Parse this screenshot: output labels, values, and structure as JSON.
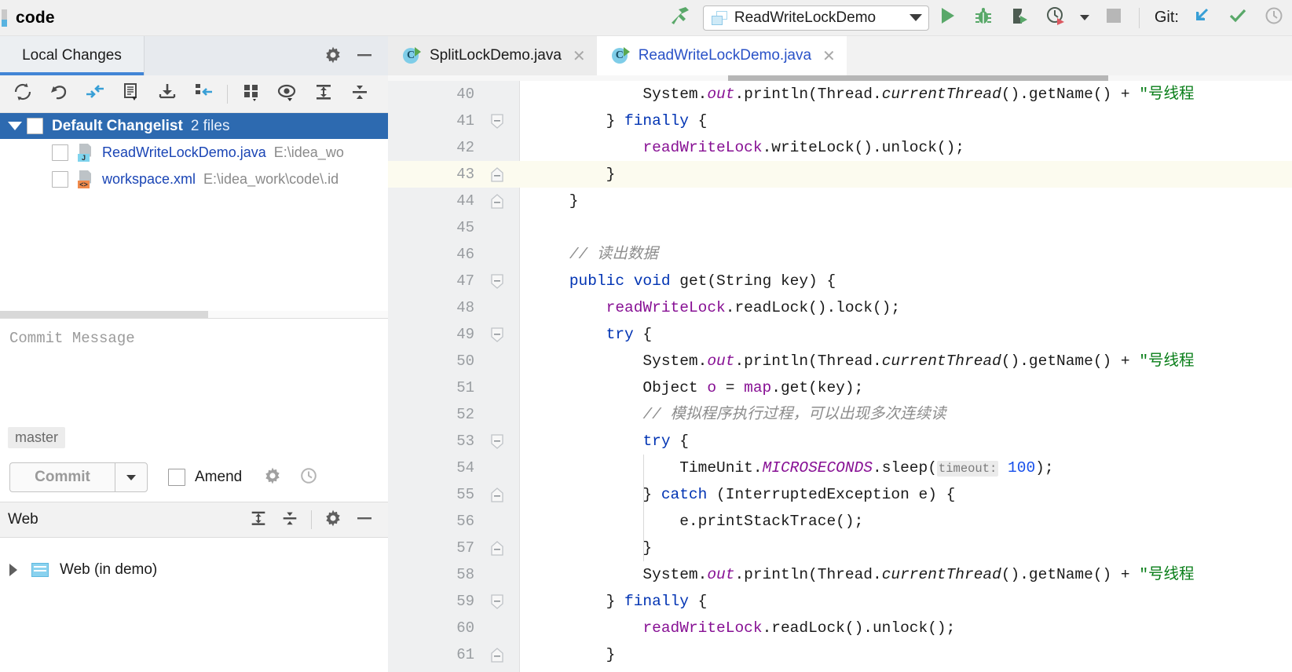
{
  "toolbar": {
    "project_name": "code",
    "build_icon": "hammer-icon",
    "run_config": {
      "label": "ReadWriteLockDemo",
      "icon": "application-config-icon"
    },
    "actions": [
      {
        "name": "run-button",
        "icon": "run-triangle-icon"
      },
      {
        "name": "debug-button",
        "icon": "bug-icon"
      },
      {
        "name": "run-with-coverage-button",
        "icon": "coverage-shield-icon"
      },
      {
        "name": "profiler-button",
        "icon": "clock-profiler-icon"
      },
      {
        "name": "stop-button",
        "icon": "stop-square-icon"
      }
    ],
    "git": {
      "label": "Git:",
      "update_icon": "update-arrow-icon",
      "commit_icon": "checkmark-icon",
      "history_icon": "clock-history-icon"
    }
  },
  "local_changes": {
    "tab_label": "Local Changes",
    "header_tools": [
      {
        "name": "settings-button",
        "icon": "gear-icon"
      },
      {
        "name": "hide-button",
        "icon": "minimize-icon"
      }
    ],
    "toolbar": [
      {
        "name": "refresh-button",
        "icon": "refresh-icon"
      },
      {
        "name": "rollback-button",
        "icon": "rollback-arrow-icon"
      },
      {
        "name": "show-diff-button",
        "icon": "diff-arrows-icon"
      },
      {
        "name": "edit-source-button",
        "icon": "document-icon"
      },
      {
        "name": "get-from-vcs-button",
        "icon": "download-icon"
      },
      {
        "name": "move-to-changelist-button",
        "icon": "move-changelist-icon"
      },
      {
        "name": "group-by-button",
        "icon": "group-by-icon"
      },
      {
        "name": "preview-diff-button",
        "icon": "eye-icon"
      },
      {
        "name": "expand-all-button",
        "icon": "expand-all-icon"
      },
      {
        "name": "collapse-all-button",
        "icon": "collapse-all-icon"
      }
    ],
    "changelist": {
      "name": "Default Changelist",
      "count_label": "2 files",
      "expanded": true
    },
    "files": [
      {
        "name": "ReadWriteLockDemo.java",
        "path": "E:\\idea_wo",
        "badge": "J",
        "badge_type": "java"
      },
      {
        "name": "workspace.xml",
        "path": "E:\\idea_work\\code\\.id",
        "badge": "<>",
        "badge_type": "xml"
      }
    ],
    "commit_message_placeholder": "Commit Message",
    "branch": "master",
    "commit_button": "Commit",
    "amend_label": "Amend",
    "commit_tools": [
      {
        "name": "commit-settings-button",
        "icon": "gear-icon"
      },
      {
        "name": "commit-history-button",
        "icon": "clock-history-icon"
      }
    ]
  },
  "web_panel": {
    "title": "Web",
    "tools": [
      {
        "name": "expand-all-button",
        "icon": "expand-all-icon"
      },
      {
        "name": "collapse-all-button",
        "icon": "collapse-all-icon"
      },
      {
        "name": "settings-button",
        "icon": "gear-icon"
      },
      {
        "name": "hide-button",
        "icon": "minimize-icon"
      }
    ],
    "node_label": "Web (in demo)",
    "node_expanded": false
  },
  "editor": {
    "tabs": [
      {
        "label": "SplitLockDemo.java",
        "active": false,
        "closable": true
      },
      {
        "label": "ReadWriteLockDemo.java",
        "active": true,
        "closable": true
      }
    ],
    "current_line": 43,
    "first_visible_line": 40,
    "lines": [
      {
        "n": 40,
        "fold": "",
        "indent": 0,
        "html": "            System.<span class=\"sfld\">out</span>.println(Thread.<span class=\"mth-i\">currentThread</span>().getName() + <span class=\"str\">\"号线程</span>"
      },
      {
        "n": 41,
        "fold": "start",
        "indent": 0,
        "html": "        } <span class=\"kw\">finally</span> {"
      },
      {
        "n": 42,
        "fold": "",
        "indent": 0,
        "html": "            <span class=\"fld\">readWriteLock</span>.writeLock().unlock();"
      },
      {
        "n": 43,
        "fold": "end",
        "indent": 0,
        "html": "        }"
      },
      {
        "n": 44,
        "fold": "end",
        "indent": 0,
        "html": "    }"
      },
      {
        "n": 45,
        "fold": "",
        "indent": 0,
        "html": ""
      },
      {
        "n": 46,
        "fold": "",
        "indent": 0,
        "html": "    <span class=\"cmt\">// 读出数据</span>"
      },
      {
        "n": 47,
        "fold": "start",
        "indent": 0,
        "html": "    <span class=\"kw\">public</span> <span class=\"kw\">void</span> get(String key) {"
      },
      {
        "n": 48,
        "fold": "",
        "indent": 0,
        "html": "        <span class=\"fld\">readWriteLock</span>.readLock().lock();"
      },
      {
        "n": 49,
        "fold": "start",
        "indent": 0,
        "html": "        <span class=\"kw\">try</span> {"
      },
      {
        "n": 50,
        "fold": "",
        "indent": 0,
        "html": "            System.<span class=\"sfld\">out</span>.println(Thread.<span class=\"mth-i\">currentThread</span>().getName() + <span class=\"str\">\"号线程</span>"
      },
      {
        "n": 51,
        "fold": "",
        "indent": 0,
        "html": "            Object <span class=\"fld\">o</span> = <span class=\"fld\">map</span>.get(key);"
      },
      {
        "n": 52,
        "fold": "",
        "indent": 0,
        "html": "            <span class=\"cmt\">// 模拟程序执行过程，可以出现多次连续读</span>"
      },
      {
        "n": 53,
        "fold": "start",
        "indent": 0,
        "html": "            <span class=\"kw\">try</span> {"
      },
      {
        "n": 54,
        "fold": "",
        "indent": 1,
        "html": "                TimeUnit.<span class=\"sfld\">MICROSECONDS</span>.sleep(<span class=\"param-hint\">timeout:</span> <span class=\"num\">100</span>);"
      },
      {
        "n": 55,
        "fold": "end",
        "indent": 1,
        "html": "            } <span class=\"kw\">catch</span> (InterruptedException e) {"
      },
      {
        "n": 56,
        "fold": "",
        "indent": 1,
        "html": "                e.printStackTrace();"
      },
      {
        "n": 57,
        "fold": "end",
        "indent": 1,
        "html": "            }"
      },
      {
        "n": 58,
        "fold": "",
        "indent": 0,
        "html": "            System.<span class=\"sfld\">out</span>.println(Thread.<span class=\"mth-i\">currentThread</span>().getName() + <span class=\"str\">\"号线程</span>"
      },
      {
        "n": 59,
        "fold": "start",
        "indent": 0,
        "html": "        } <span class=\"kw\">finally</span> {"
      },
      {
        "n": 60,
        "fold": "",
        "indent": 0,
        "html": "            <span class=\"fld\">readWriteLock</span>.readLock().unlock();"
      },
      {
        "n": 61,
        "fold": "end",
        "indent": 0,
        "html": "        }"
      }
    ]
  },
  "colors": {
    "selection_blue": "#2d6ab0",
    "accent_blue": "#4285d6",
    "link_blue": "#1a45b5",
    "keyword": "#0033b3",
    "string_green": "#077d17",
    "field_purple": "#871094",
    "comment_gray": "#8c8c8c",
    "number_blue": "#1750eb",
    "current_line_bg": "#fcfbef"
  }
}
